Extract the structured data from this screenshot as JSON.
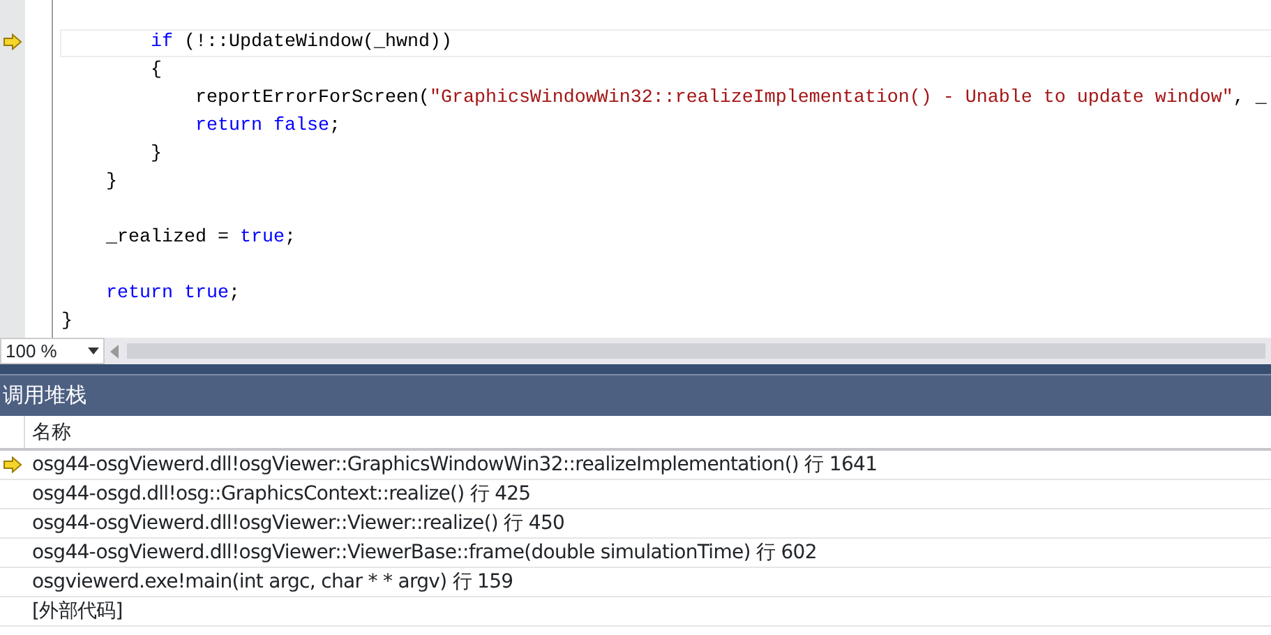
{
  "editor": {
    "lines": [
      {
        "current": false
      },
      {
        "children": [
          {
            "children": [
              {
                "current": true,
                "tokens": [
                  {
                    "kind": "keyword",
                    "text": "if"
                  },
                  {
                    "kind": "plain",
                    "text": "(!::UpdateWindow(_hwnd))",
                    "spaced": true
                  }
                ]
              },
              {
                "current": false,
                "tokens": [
                  {
                    "kind": "plain",
                    "text": "{"
                  }
                ]
              },
              {
                "children": [
                  {
                    "current": false,
                    "tokens": [
                      {
                        "kind": "plain",
                        "text": "reportErrorForScreen("
                      },
                      {
                        "kind": "string",
                        "text": "\"GraphicsWindowWin32::realizeImplementation() - Unable to update window\""
                      },
                      {
                        "kind": "plain",
                        "text": ", _"
                      }
                    ]
                  },
                  {
                    "current": false,
                    "tokens": [
                      {
                        "kind": "keyword",
                        "text": "return"
                      },
                      {
                        "kind": "keyword",
                        "text": "false",
                        "spaced": true
                      },
                      {
                        "kind": "plain",
                        "text": ";"
                      }
                    ]
                  }
                ]
              },
              {
                "current": false,
                "tokens": [
                  {
                    "kind": "plain",
                    "text": "}"
                  }
                ]
              }
            ]
          },
          {
            "current": false,
            "tokens": [
              {
                "kind": "plain",
                "text": "}"
              }
            ]
          },
          {
            "current": false
          },
          {
            "current": false,
            "tokens": [
              {
                "kind": "plain",
                "text": "_realized ="
              },
              {
                "kind": "keyword",
                "text": "true",
                "spaced": true
              },
              {
                "kind": "plain",
                "text": ";"
              }
            ]
          },
          {
            "current": false
          },
          {
            "current": false,
            "tokens": [
              {
                "kind": "keyword",
                "text": "return"
              },
              {
                "kind": "keyword",
                "text": "true",
                "spaced": true
              },
              {
                "kind": "plain",
                "text": ";"
              }
            ]
          }
        ]
      },
      {
        "current": false,
        "tokens": [
          {
            "kind": "plain",
            "text": "}"
          }
        ]
      }
    ],
    "zoom": "100 %"
  },
  "call_stack": {
    "title": "调用堆栈",
    "columns": [
      "名称"
    ],
    "rows": [
      {
        "name": "osg44-osgViewerd.dll!osgViewer::GraphicsWindowWin32::realizeImplementation() 行 1641",
        "current": true
      },
      {
        "name": "osg44-osgd.dll!osg::GraphicsContext::realize() 行 425",
        "current": false
      },
      {
        "name": "osg44-osgViewerd.dll!osgViewer::Viewer::realize() 行 450",
        "current": false
      },
      {
        "name": "osg44-osgViewerd.dll!osgViewer::ViewerBase::frame(double simulationTime) 行 602",
        "current": false
      },
      {
        "name": "osgviewerd.exe!main(int argc, char * * argv) 行 159",
        "current": false
      },
      {
        "name": "[外部代码]",
        "current": false
      }
    ]
  }
}
